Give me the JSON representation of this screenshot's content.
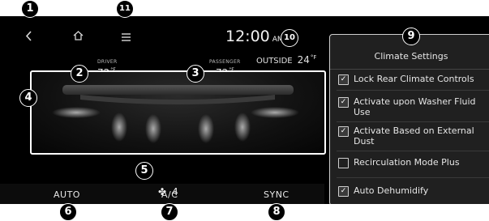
{
  "header": {
    "back_icon": "chevron-left-icon",
    "home_icon": "home-icon",
    "menu_icon": "menu-icon",
    "time": "12:00",
    "ampm": "AM",
    "outside_label": "OUTSIDE",
    "outside_temp": "24",
    "outside_unit": "°F"
  },
  "driver": {
    "label": "DRIVER",
    "temp": "72",
    "unit": "°F"
  },
  "passenger": {
    "label": "PASSENGER",
    "temp": "72",
    "unit": "°F"
  },
  "fan": {
    "icon": "fan-icon",
    "speed": "4"
  },
  "bottom": {
    "auto": "AUTO",
    "ac": "A/C",
    "sync": "SYNC"
  },
  "settings_panel": {
    "title": "Climate Settings",
    "options": [
      {
        "label": "Lock Rear Climate Controls",
        "checked": true
      },
      {
        "label": "Activate upon Washer Fluid Use",
        "checked": true
      },
      {
        "label": "Activate Based on External Dust",
        "checked": true
      },
      {
        "label": "Recirculation Mode Plus",
        "checked": false
      },
      {
        "label": "Auto Dehumidify",
        "checked": true
      }
    ]
  },
  "callouts": [
    "1",
    "2",
    "3",
    "4",
    "5",
    "6",
    "7",
    "8",
    "9",
    "10",
    "11"
  ]
}
